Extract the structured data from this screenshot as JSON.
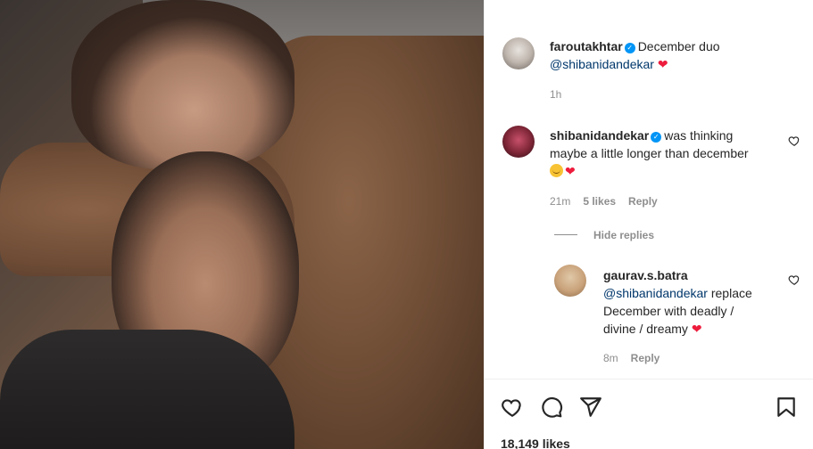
{
  "post": {
    "caption": {
      "username": "faroutakhtar",
      "text": "December duo",
      "mention": "@shibanidandekar",
      "time": "1h"
    },
    "comments": [
      {
        "username": "shibanidandekar",
        "text_line1": "was thinking",
        "text_line2": "maybe a little longer than december",
        "time": "21m",
        "likes": "5 likes",
        "reply_label": "Reply"
      }
    ],
    "hide_replies_label": "Hide replies",
    "replies": [
      {
        "username": "gaurav.s.batra",
        "mention": "@shibanidandekar",
        "text_line1": "replace",
        "text_line2": "December with deadly /",
        "text_line3": "divine / dreamy",
        "time": "8m",
        "reply_label": "Reply"
      }
    ],
    "likes_count": "18,149 likes"
  },
  "icons": {
    "verified": "verified-badge-icon",
    "heart": "heart-icon",
    "comment": "comment-icon",
    "share": "share-icon",
    "save": "bookmark-icon"
  },
  "colors": {
    "verified": "#0095f6",
    "mention": "#00376b",
    "heart_emoji": "#ed1c3c",
    "meta": "#8e8e8e"
  }
}
